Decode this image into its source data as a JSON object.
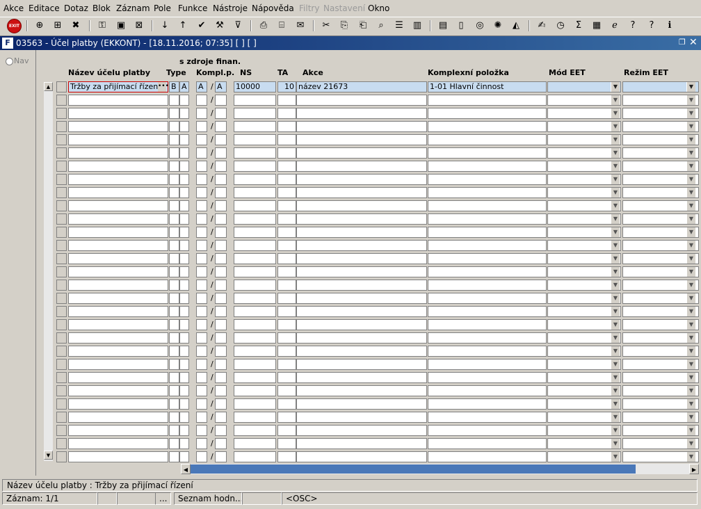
{
  "menu": [
    "Akce",
    "Editace",
    "Dotaz",
    "Blok",
    "Záznam",
    "Pole",
    "Funkce",
    "Nástroje",
    "Nápověda",
    "Filtry",
    "Nastavení",
    "Okno"
  ],
  "menu_disabled": [
    "Filtry",
    "Nastavení"
  ],
  "toolbar": {
    "exit_label": "EXIT",
    "icons": [
      "add-record-icon",
      "add-copy-icon",
      "delete-icon",
      "query-icon",
      "query-run-icon",
      "query-cancel-icon",
      "sort-asc-icon",
      "sort-desc-icon",
      "confirm-check-icon",
      "wrench-icon",
      "filter-icon",
      "print-icon",
      "fax-icon",
      "mail-icon",
      "cut-icon",
      "copy-icon",
      "paste-icon",
      "find-icon",
      "indent-icon",
      "columns-icon",
      "document-icon",
      "document-blank-icon",
      "globe-icon",
      "ship-wheel-icon",
      "eye-icon",
      "signature-icon",
      "clock-icon",
      "sigma-icon",
      "excel-icon",
      "ie-icon",
      "help-icon",
      "context-help-icon",
      "info-icon"
    ]
  },
  "window": {
    "title": "03563 - Účel platby (EKKONT) - [18.11.2016; 07:35]  [ ]  [ ]",
    "nav_label": "Nav"
  },
  "columns": {
    "group_label": "s zdroje finan.",
    "nazev": "Název účelu platby",
    "type": "Type",
    "kompl": "Kompl.p.",
    "ns": "NS",
    "ta": "TA",
    "akce": "Akce",
    "komplexni": "Komplexní položka",
    "mod_eet": "Mód EET",
    "rezim_eet": "Režim EET"
  },
  "first_row": {
    "nazev": "Tržby za přijímací řízení",
    "type1": "B",
    "type2": "A",
    "kompl1": "A",
    "slash": "/",
    "kompl2": "A",
    "ns": "10000",
    "ta": "10",
    "akce": "název 21673",
    "komplexni": "1-01 Hlavní činnost",
    "mod_eet": "",
    "rezim_eet": ""
  },
  "rows_total": 29,
  "hint": "Název účelu platby : Tržby za přijímací řízení",
  "status": {
    "record": "Záznam: 1/1",
    "c2": "",
    "c3": "",
    "c4": "...",
    "c5": "Seznam hodn...",
    "c6": "",
    "c7": "<OSC>"
  }
}
